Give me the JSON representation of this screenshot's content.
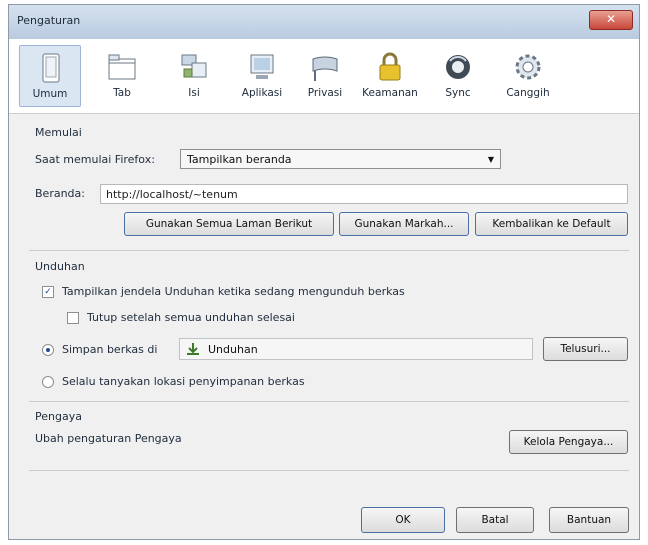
{
  "window": {
    "title": "Pengaturan",
    "close_label": "✕"
  },
  "toolbar": {
    "items": [
      {
        "label": "Umum",
        "icon": "general-icon"
      },
      {
        "label": "Tab",
        "icon": "tabs-icon"
      },
      {
        "label": "Isi",
        "icon": "content-icon"
      },
      {
        "label": "Aplikasi",
        "icon": "applications-icon"
      },
      {
        "label": "Privasi",
        "icon": "privacy-icon"
      },
      {
        "label": "Keamanan",
        "icon": "lock-icon"
      },
      {
        "label": "Sync",
        "icon": "sync-icon"
      },
      {
        "label": "Canggih",
        "icon": "gear-icon"
      }
    ],
    "active_index": 0
  },
  "startup": {
    "section_title": "Memulai",
    "start_label": "Saat memulai Firefox:",
    "start_value": "Tampilkan beranda",
    "home_label": "Beranda:",
    "home_value": "http://localhost/~tenum",
    "btn_current": "Gunakan Semua Laman Berikut",
    "btn_bookmark": "Gunakan Markah...",
    "btn_default": "Kembalikan ke Default"
  },
  "downloads": {
    "section_title": "Unduhan",
    "show_window": "Tampilkan jendela Unduhan ketika sedang mengunduh berkas",
    "close_when_done": "Tutup setelah semua unduhan selesai",
    "save_to_label": "Simpan berkas di",
    "save_to_folder": "Unduhan",
    "browse_button": "Telusuri...",
    "always_ask": "Selalu tanyakan lokasi penyimpanan berkas"
  },
  "addons": {
    "section_title": "Pengaya",
    "description": "Ubah pengaturan Pengaya",
    "manage_button": "Kelola Pengaya..."
  },
  "footer": {
    "ok": "OK",
    "cancel": "Batal",
    "help": "Bantuan"
  }
}
